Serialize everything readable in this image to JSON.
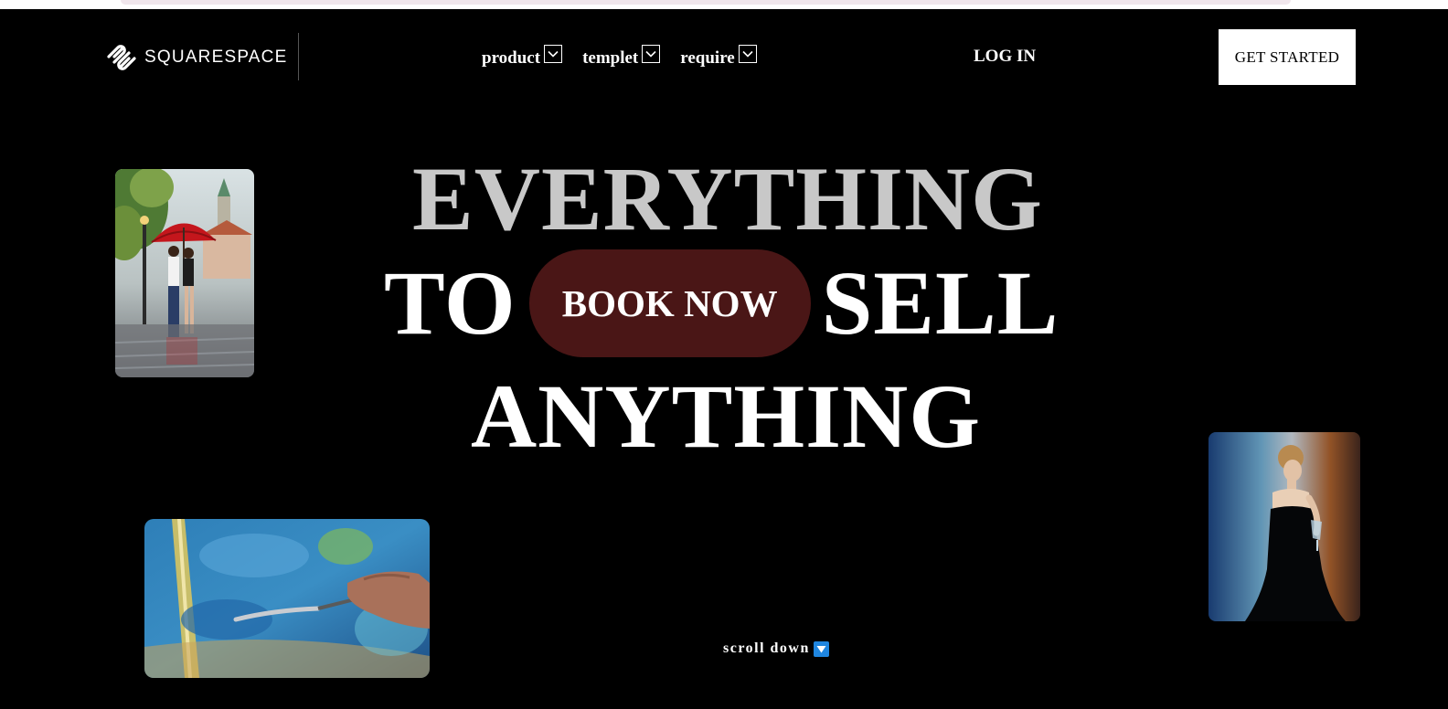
{
  "header": {
    "brand": "SQUARESPACE",
    "nav": [
      {
        "label": "product",
        "icon": "chevron-down-icon"
      },
      {
        "label": "templet",
        "icon": "chevron-down-icon"
      },
      {
        "label": "require",
        "icon": "chevron-down-icon"
      }
    ],
    "login_label": "LOG IN",
    "cta_label": "GET STARTED"
  },
  "hero": {
    "line1": "EVERYTHING",
    "line2_left": "TO",
    "book_now_label": "BOOK NOW",
    "line2_right": "SELL",
    "line3": "ANYTHING"
  },
  "scroll": {
    "label": "scroll down",
    "icon": "arrow-down-icon"
  },
  "colors": {
    "background": "#000000",
    "hero_line1": "#c8c8c8",
    "book_now_bg": "#4a1616",
    "scroll_icon_bg": "#1f86e0",
    "cta_bg": "#ffffff"
  }
}
